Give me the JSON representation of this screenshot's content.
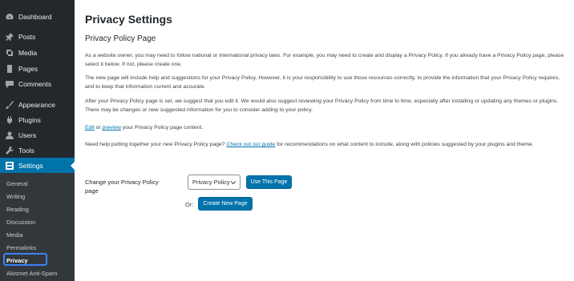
{
  "sidebar": {
    "items": [
      {
        "label": "Dashboard",
        "icon": "dashboard-icon"
      },
      {
        "label": "Posts",
        "icon": "pin-icon"
      },
      {
        "label": "Media",
        "icon": "media-icon"
      },
      {
        "label": "Pages",
        "icon": "pages-icon"
      },
      {
        "label": "Comments",
        "icon": "comments-icon"
      },
      {
        "label": "Appearance",
        "icon": "brush-icon"
      },
      {
        "label": "Plugins",
        "icon": "plugin-icon"
      },
      {
        "label": "Users",
        "icon": "users-icon"
      },
      {
        "label": "Tools",
        "icon": "wrench-icon"
      },
      {
        "label": "Settings",
        "icon": "settings-icon"
      }
    ],
    "submenu": [
      "General",
      "Writing",
      "Reading",
      "Discussion",
      "Media",
      "Permalinks",
      "Privacy",
      "Akismet Anti-Spam"
    ]
  },
  "main": {
    "title": "Privacy Settings",
    "section_title": "Privacy Policy Page",
    "para1": "As a website owner, you may need to follow national or international privacy laws. For example, you may need to create and display a Privacy Policy. If you already have a Privacy Policy page, please select it below. If not, please create one.",
    "para2": "The new page will include help and suggestions for your Privacy Policy. However, it is your responsibility to use those resources correctly, to provide the information that your Privacy Policy requires, and to keep that information current and accurate.",
    "para3": "After your Privacy Policy page is set, we suggest that you edit it. We would also suggest reviewing your Privacy Policy from time to time, especially after installing or updating any themes or plugins. There may be changes or new suggested information for you to consider adding to your policy.",
    "edit_link": "Edit",
    "or_text": " or ",
    "preview_link": "preview",
    "edit_suffix": " your Privacy Policy page content.",
    "help_prefix": "Need help putting together your new Privacy Policy page? ",
    "guide_link": "Check out our guide",
    "help_suffix": " for recommendations on what content to include, along with policies suggested by your plugins and theme.",
    "form_label": "Change your Privacy Policy page",
    "select_value": "Privacy Policy",
    "use_button": "Use This Page",
    "or_label": "Or:",
    "create_button": "Create New Page"
  },
  "colors": {
    "sidebar": "#23282d",
    "accent": "#0073aa",
    "highlight": "#3b82f6"
  }
}
